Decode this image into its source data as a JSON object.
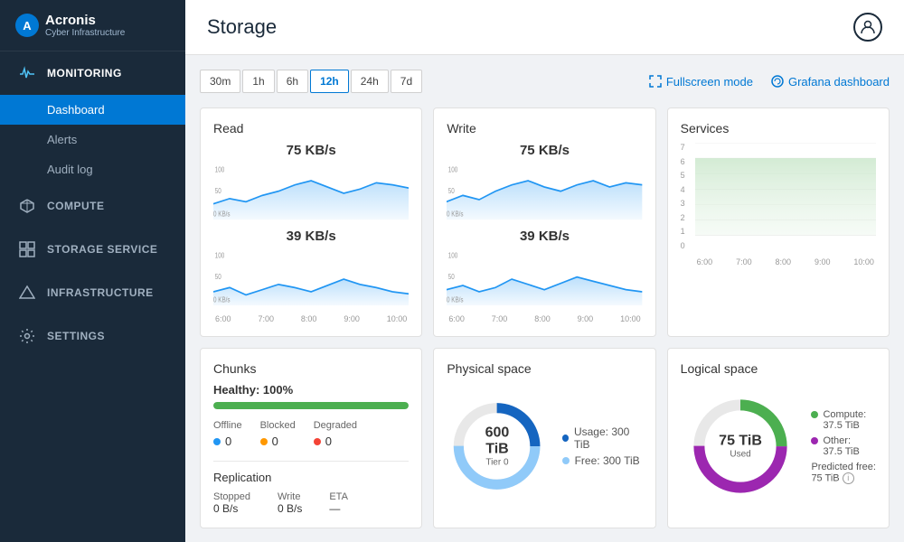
{
  "sidebar": {
    "logo": {
      "brand": "Acronis",
      "product": "Cyber Infrastructure"
    },
    "nav": [
      {
        "id": "monitoring",
        "icon": "pulse",
        "label": "MONITORING",
        "active": true,
        "subItems": [
          {
            "id": "dashboard",
            "label": "Dashboard",
            "active": true
          },
          {
            "id": "alerts",
            "label": "Alerts",
            "active": false
          },
          {
            "id": "auditlog",
            "label": "Audit log",
            "active": false
          }
        ]
      },
      {
        "id": "compute",
        "icon": "cube",
        "label": "COMPUTE",
        "active": false,
        "subItems": []
      },
      {
        "id": "storage",
        "icon": "grid",
        "label": "STORAGE SERVICE",
        "active": false,
        "subItems": []
      },
      {
        "id": "infrastructure",
        "icon": "triangle",
        "label": "INFRASTRUCTURE",
        "active": false,
        "subItems": []
      },
      {
        "id": "settings",
        "icon": "gear",
        "label": "SETTINGS",
        "active": false,
        "subItems": []
      }
    ]
  },
  "header": {
    "title": "Storage",
    "userIcon": "👤"
  },
  "toolbar": {
    "timeButtons": [
      "30m",
      "1h",
      "6h",
      "12h",
      "24h",
      "7d"
    ],
    "activeTime": "12h",
    "fullscreen": "Fullscreen mode",
    "grafana": "Grafana dashboard"
  },
  "cards": {
    "read": {
      "title": "Read",
      "value1": "75 KB/s",
      "value2": "39 KB/s",
      "xLabels": [
        "6:00",
        "7:00",
        "8:00",
        "9:00",
        "10:00"
      ]
    },
    "write": {
      "title": "Write",
      "value1": "75 KB/s",
      "value2": "39 KB/s",
      "xLabels": [
        "6:00",
        "7:00",
        "8:00",
        "9:00",
        "10:00"
      ]
    },
    "services": {
      "title": "Services",
      "yLabels": [
        "7",
        "6",
        "5",
        "4",
        "3",
        "2",
        "1",
        "0"
      ],
      "xLabels": [
        "6:00",
        "7:00",
        "8:00",
        "9:00",
        "10:00"
      ]
    },
    "chunks": {
      "title": "Chunks",
      "healthyLabel": "Healthy:",
      "healthyValue": "100%",
      "progressPercent": 100,
      "offline": {
        "label": "Offline",
        "value": "0"
      },
      "blocked": {
        "label": "Blocked",
        "value": "0"
      },
      "degraded": {
        "label": "Degraded",
        "value": "0"
      },
      "replication": {
        "title": "Replication",
        "stopped": {
          "label": "Stopped",
          "value": "0 B/s"
        },
        "write": {
          "label": "Write",
          "value": "0 B/s"
        },
        "eta": {
          "label": "ETA",
          "value": "—"
        }
      }
    },
    "physicalSpace": {
      "title": "Physical space",
      "donutValue": "600 TiB",
      "donutSub": "Tier 0",
      "usageLabel": "Usage:",
      "usageValue": "300 TiB",
      "freeLabel": "Free:",
      "freeValue": "300 TiB"
    },
    "logicalSpace": {
      "title": "Logical space",
      "donutValue": "75 TiB",
      "donutSub": "Used",
      "compute": {
        "label": "Compute:",
        "value": "37.5 TiB"
      },
      "other": {
        "label": "Other:",
        "value": "37.5 TiB"
      },
      "predictedFree": {
        "label": "Predicted free:",
        "value": "75 TiB"
      }
    }
  }
}
